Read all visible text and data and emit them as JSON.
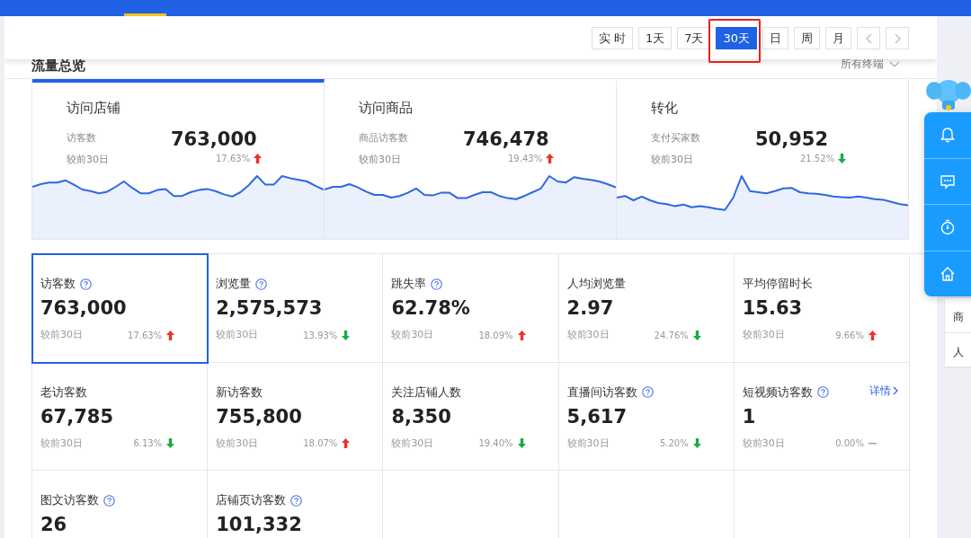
{
  "toolbar": {
    "buttons": [
      {
        "label": "实 时",
        "selected": false,
        "highlighted": false
      },
      {
        "label": "1天",
        "selected": false,
        "highlighted": false
      },
      {
        "label": "7天",
        "selected": false,
        "highlighted": false
      },
      {
        "label": "30天",
        "selected": true,
        "highlighted": true
      },
      {
        "label": "日",
        "selected": false,
        "highlighted": false
      },
      {
        "label": "周",
        "selected": false,
        "highlighted": false
      },
      {
        "label": "月",
        "selected": false,
        "highlighted": false
      }
    ]
  },
  "section": {
    "title": "流量总览",
    "filter": "所有终端"
  },
  "overview_cards": [
    {
      "title": "访问店铺",
      "metric": "访客数",
      "value": "763,000",
      "compare": "较前30日",
      "change": "17.63%",
      "kind": "up",
      "selected": true
    },
    {
      "title": "访问商品",
      "metric": "商品访客数",
      "value": "746,478",
      "compare": "较前30日",
      "change": "19.43%",
      "kind": "up",
      "selected": false
    },
    {
      "title": "转化",
      "metric": "支付买家数",
      "value": "50,952",
      "compare": "较前30日",
      "change": "21.52%",
      "kind": "down",
      "selected": false
    }
  ],
  "metrics": [
    {
      "label": "访客数",
      "help": true,
      "value": "763,000",
      "compare": "较前30日",
      "change": "17.63%",
      "kind": "up",
      "selected": true
    },
    {
      "label": "浏览量",
      "help": true,
      "value": "2,575,573",
      "compare": "较前30日",
      "change": "13.93%",
      "kind": "down",
      "selected": false
    },
    {
      "label": "跳失率",
      "help": true,
      "value": "62.78%",
      "compare": "较前30日",
      "change": "18.09%",
      "kind": "up",
      "selected": false
    },
    {
      "label": "人均浏览量",
      "help": false,
      "value": "2.97",
      "compare": "较前30日",
      "change": "24.76%",
      "kind": "down",
      "selected": false
    },
    {
      "label": "平均停留时长",
      "help": false,
      "value": "15.63",
      "compare": "较前30日",
      "change": "9.66%",
      "kind": "up",
      "selected": false
    },
    {
      "label": "老访客数",
      "help": false,
      "value": "67,785",
      "compare": "较前30日",
      "change": "6.13%",
      "kind": "down",
      "selected": false
    },
    {
      "label": "新访客数",
      "help": false,
      "value": "755,800",
      "compare": "较前30日",
      "change": "18.07%",
      "kind": "up",
      "selected": false
    },
    {
      "label": "关注店铺人数",
      "help": false,
      "value": "8,350",
      "compare": "较前30日",
      "change": "19.40%",
      "kind": "down",
      "selected": false
    },
    {
      "label": "直播间访客数",
      "help": true,
      "value": "5,617",
      "compare": "较前30日",
      "change": "5.20%",
      "kind": "down",
      "selected": false
    },
    {
      "label": "短视频访客数",
      "help": true,
      "value": "1",
      "compare": "较前30日",
      "change": "0.00%",
      "kind": "flat",
      "selected": false,
      "link": "详情"
    },
    {
      "label": "图文访客数",
      "help": true,
      "value": "26",
      "selected": false
    },
    {
      "label": "店铺页访客数",
      "help": true,
      "value": "101,332",
      "selected": false
    }
  ],
  "side_panel": {
    "items": [
      "商",
      "人"
    ]
  }
}
